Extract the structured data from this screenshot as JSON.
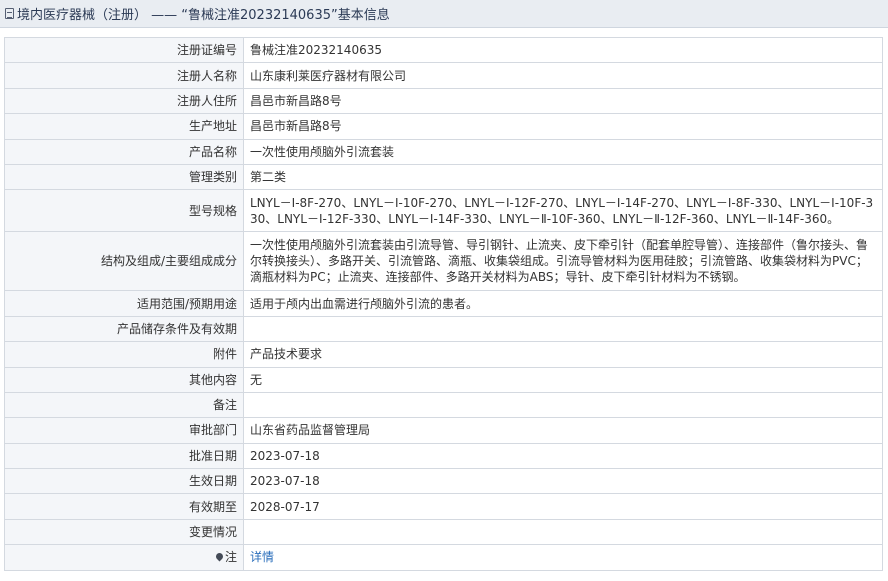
{
  "header": {
    "title": "境内医疗器械（注册） —— “鲁械注准20232140635”基本信息"
  },
  "rows": [
    {
      "label": "注册证编号",
      "value": "鲁械注准20232140635"
    },
    {
      "label": "注册人名称",
      "value": "山东康利莱医疗器材有限公司"
    },
    {
      "label": "注册人住所",
      "value": "昌邑市新昌路8号"
    },
    {
      "label": "生产地址",
      "value": "昌邑市新昌路8号"
    },
    {
      "label": "产品名称",
      "value": "一次性使用颅脑外引流套装"
    },
    {
      "label": "管理类别",
      "value": "第二类"
    },
    {
      "label": "型号规格",
      "value": "LNYL－Ⅰ-8F-270、LNYL－Ⅰ-10F-270、LNYL－Ⅰ-12F-270、LNYL－Ⅰ-14F-270、LNYL－Ⅰ-8F-330、LNYL－Ⅰ-10F-330、LNYL－Ⅰ-12F-330、LNYL－Ⅰ-14F-330、LNYL－Ⅱ-10F-360、LNYL－Ⅱ-12F-360、LNYL－Ⅱ-14F-360。"
    },
    {
      "label": "结构及组成/主要组成成分",
      "value": "一次性使用颅脑外引流套装由引流导管、导引钢针、止流夹、皮下牵引针（配套单腔导管）、连接部件（鲁尔接头、鲁尔转换接头）、多路开关、引流管路、滴瓶、收集袋组成。引流导管材料为医用硅胶；引流管路、收集袋材料为PVC；滴瓶材料为PC；止流夹、连接部件、多路开关材料为ABS；导针、皮下牵引针材料为不锈钢。"
    },
    {
      "label": "适用范围/预期用途",
      "value": "适用于颅内出血需进行颅脑外引流的患者。"
    },
    {
      "label": "产品储存条件及有效期",
      "value": ""
    },
    {
      "label": "附件",
      "value": "产品技术要求"
    },
    {
      "label": "其他内容",
      "value": "无"
    },
    {
      "label": "备注",
      "value": ""
    },
    {
      "label": "审批部门",
      "value": "山东省药品监督管理局"
    },
    {
      "label": "批准日期",
      "value": "2023-07-18"
    },
    {
      "label": "生效日期",
      "value": "2023-07-18"
    },
    {
      "label": "有效期至",
      "value": "2028-07-17"
    },
    {
      "label": "变更情况",
      "value": ""
    },
    {
      "label": "注",
      "value": "详情"
    }
  ]
}
